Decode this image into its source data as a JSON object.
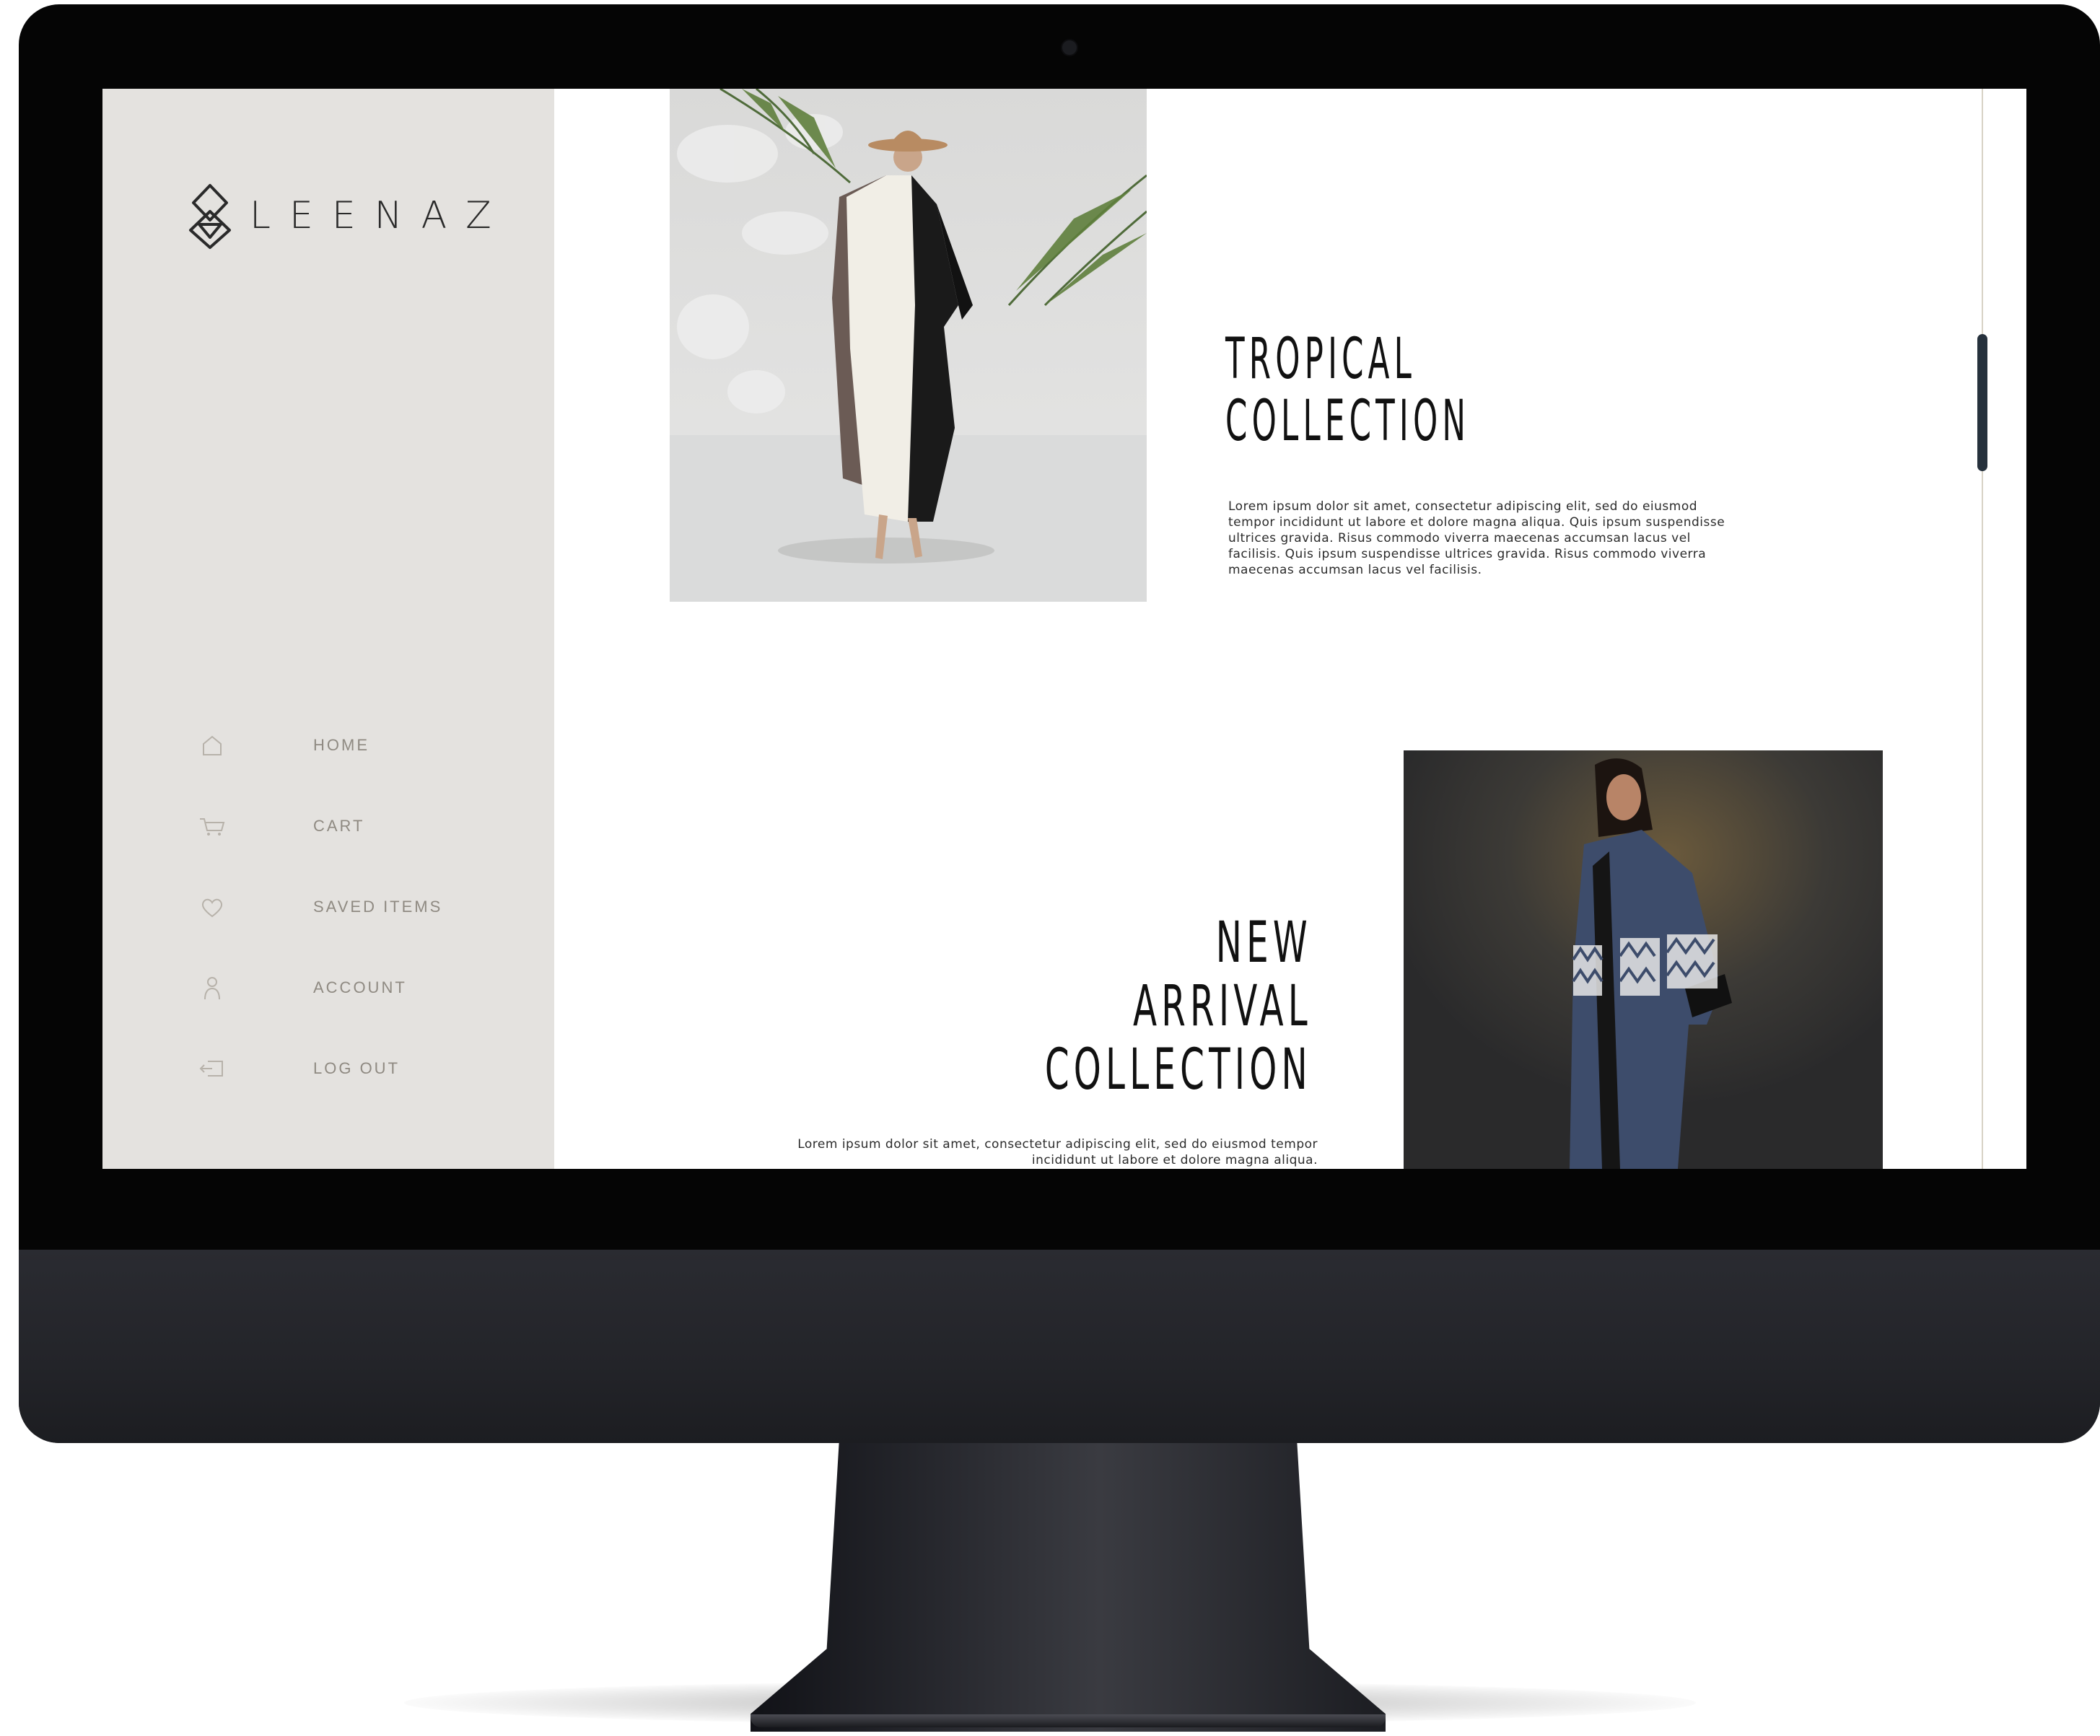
{
  "brand": {
    "name": "LEENAZ",
    "logo_icon": "leenaz-logo-mark"
  },
  "nav": {
    "items": [
      {
        "label": "HOME",
        "icon": "home-icon"
      },
      {
        "label": "CART",
        "icon": "cart-icon"
      },
      {
        "label": "SAVED ITEMS",
        "icon": "heart-icon"
      },
      {
        "label": "ACCOUNT",
        "icon": "user-icon"
      },
      {
        "label": "LOG OUT",
        "icon": "logout-icon"
      }
    ]
  },
  "collections": [
    {
      "title": "TROPICAL\nCOLLECTION",
      "description": "Lorem ipsum dolor sit amet, consectetur adipiscing elit, sed do eiusmod tempor incididunt ut labore et dolore magna aliqua. Quis ipsum suspendisse ultrices gravida. Risus commodo viverra maecenas accumsan lacus vel facilisis. Quis ipsum suspendisse ultrices gravida. Risus commodo viverra maecenas accumsan lacus vel facilisis."
    },
    {
      "title": "NEW\nARRIVAL\nCOLLECTION",
      "description": "Lorem ipsum dolor sit amet, consectetur adipiscing elit, sed do eiusmod tempor incididunt ut labore et dolore magna aliqua."
    }
  ],
  "colors": {
    "sidebar_bg": "#e4e2df",
    "nav_text": "#8f8a82",
    "scroll_thumb": "#26313c",
    "bezel": "#050505"
  }
}
